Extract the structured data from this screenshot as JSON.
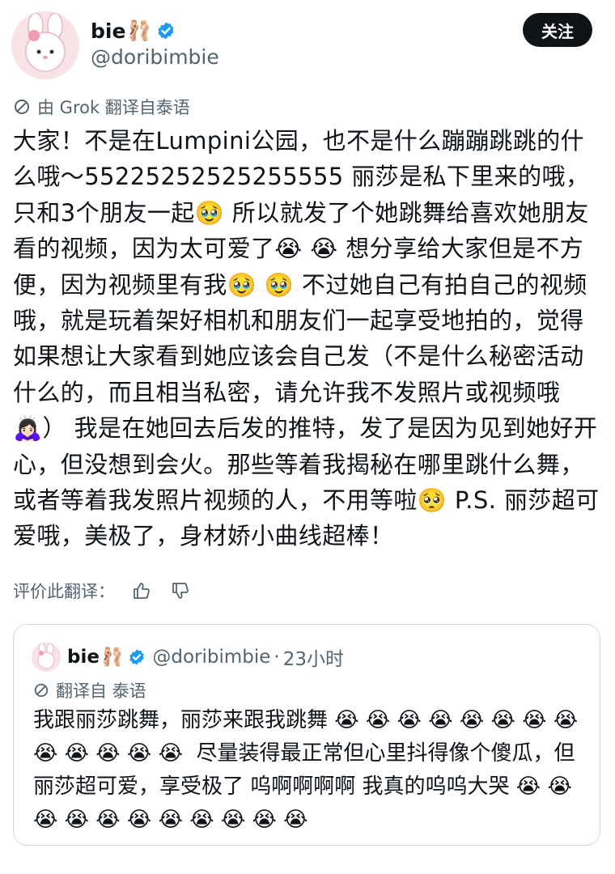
{
  "author": {
    "display_name": "bie",
    "display_emoji": "🩰",
    "handle": "@doribimbie"
  },
  "follow_label": "关注",
  "translation_note": "由 Grok 翻译自泰语",
  "post_text": "大家！不是在Lumpini公园，也不是什么蹦蹦跳跳的什么哦～55225252525255555 丽莎是私下里来的哦，只和3个朋友一起🥹 所以就发了个她跳舞给喜欢她朋友看的视频，因为太可爱了😭 😭 想分享给大家但是不方便，因为视频里有我🥹 🥹 不过她自己有拍自己的视频哦，就是玩着架好相机和朋友们一起享受地拍的，觉得如果想让大家看到她应该会自己发（不是什么秘密活动什么的，而且相当私密，请允许我不发照片或视频哦🙇🏻‍♀️） 我是在她回去后发的推特，发了是因为见到她好开心，但没想到会火。那些等着我揭秘在哪里跳什么舞，或者等着我发照片视频的人，不用等啦🥺 P.S. 丽莎超可爱哦，美极了，身材娇小曲线超棒！",
  "rate_label": "评价此翻译：",
  "icons": {
    "translate": "translate-icon",
    "verified": "verified-badge-icon",
    "thumbs_up": "thumbs-up-icon",
    "thumbs_down": "thumbs-down-icon"
  },
  "colors": {
    "verified": "#1d9bf0",
    "secondary_text": "#536471",
    "follow_bg": "#0f1419"
  },
  "quote": {
    "display_name": "bie",
    "display_emoji": "🩰",
    "handle": "@doribimbie",
    "separator": "·",
    "time": "23小时",
    "translation_note": "翻译自 泰语",
    "text": "我跟丽莎跳舞，丽莎来跟我跳舞 😭 😭 😭 😭 😭 😭 😭 😭 😭 😭 😭 😭 😭  尽量装得最正常但心里抖得像个傻瓜，但丽莎超可爱，享受极了 呜啊啊啊啊 我真的呜呜大哭 😭 😭 😭 😭 😭 😭 😭 😭 😭 😭 😭"
  }
}
